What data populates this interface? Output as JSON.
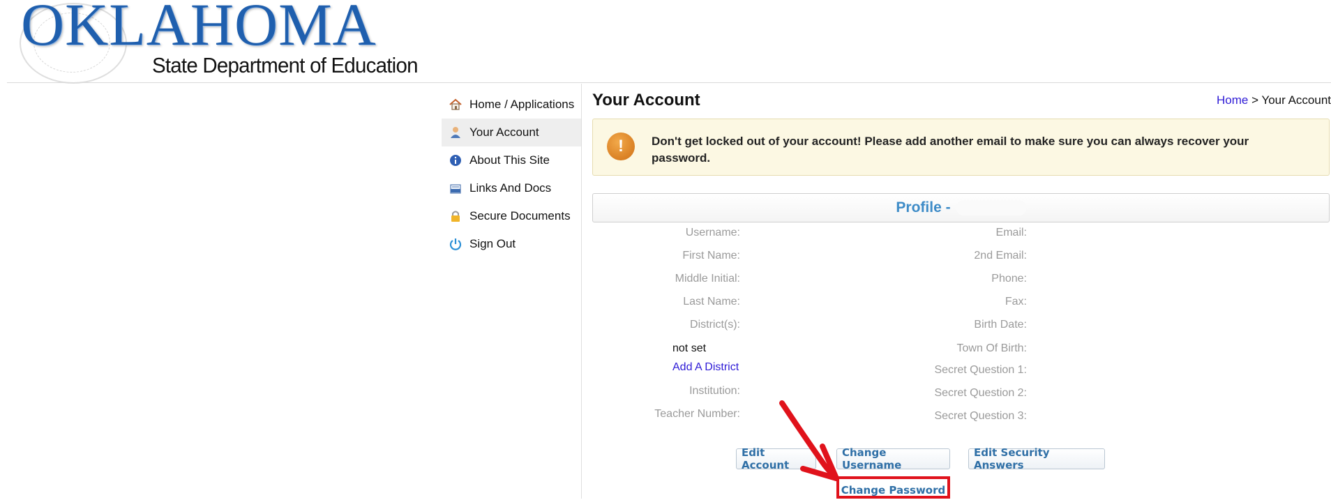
{
  "logo": {
    "title": "OKLAHOMA",
    "subtitle": "State Department of Education"
  },
  "nav": {
    "items": [
      {
        "label": "Home / Applications",
        "icon": "home-icon"
      },
      {
        "label": "Your Account",
        "icon": "user-icon",
        "active": true
      },
      {
        "label": "About This Site",
        "icon": "info-icon"
      },
      {
        "label": "Links And Docs",
        "icon": "document-icon"
      },
      {
        "label": "Secure Documents",
        "icon": "lock-icon"
      },
      {
        "label": "Sign Out",
        "icon": "power-icon"
      }
    ]
  },
  "page": {
    "title": "Your Account",
    "breadcrumb": {
      "home": "Home",
      "separator": ">",
      "current": "Your Account"
    }
  },
  "alert": {
    "icon": "!",
    "text": "Don't get locked out of your account! Please add another email to make sure you can always recover your password."
  },
  "profile": {
    "title": "Profile -",
    "left_labels": {
      "username": "Username:",
      "first_name": "First Name:",
      "middle_initial": "Middle Initial:",
      "last_name": "Last Name:",
      "districts": "District(s):",
      "institution": "Institution:",
      "teacher_number": "Teacher Number:"
    },
    "district_value": "not set",
    "add_district": "Add A District",
    "right_labels": {
      "email": "Email:",
      "email2": "2nd Email:",
      "phone": "Phone:",
      "fax": "Fax:",
      "birth_date": "Birth Date:",
      "town_of_birth": "Town Of Birth:",
      "secret1": "Secret Question 1:",
      "secret2": "Secret Question 2:",
      "secret3": "Secret Question 3:"
    }
  },
  "buttons": {
    "edit_account": "Edit Account",
    "change_username": "Change Username",
    "edit_security": "Edit Security Answers",
    "change_password": "Change Password"
  },
  "colors": {
    "highlight": "#e0121b",
    "link": "#2e1bd6",
    "profile_title": "#3d8bc7",
    "alert_bg": "#fcf8e3"
  }
}
